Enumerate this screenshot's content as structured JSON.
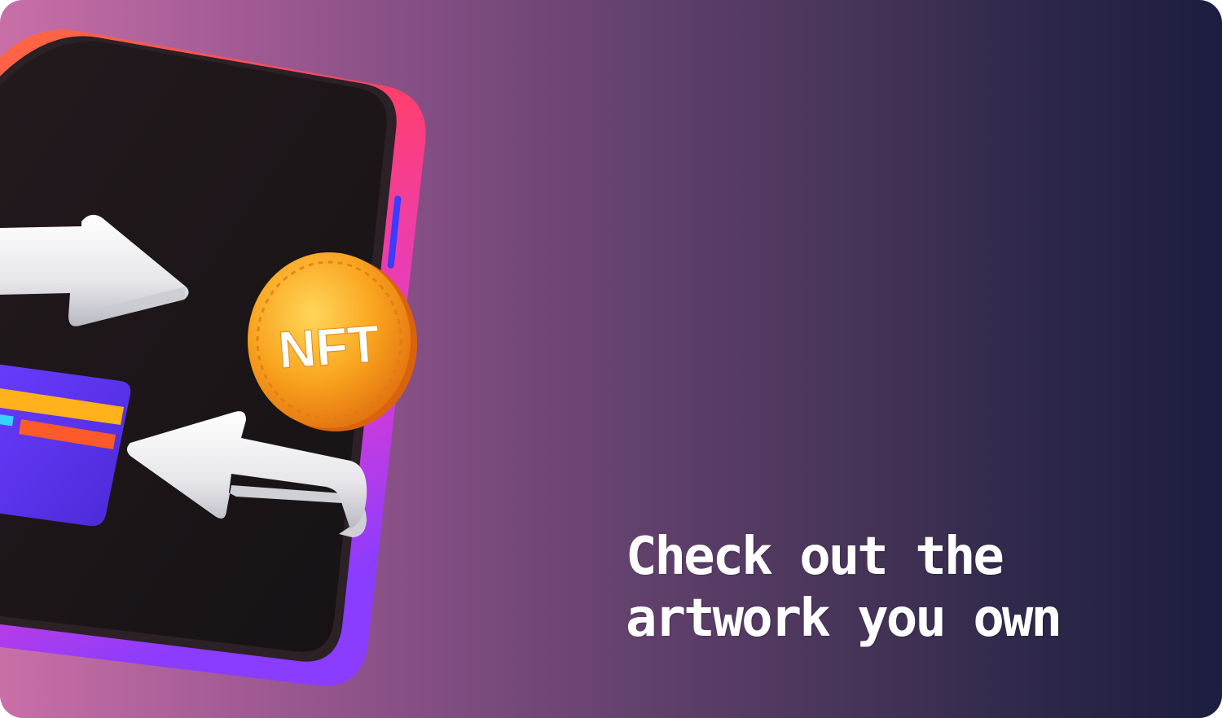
{
  "banner": {
    "coin_label": "NFT",
    "headline_line1": "Check out the",
    "headline_line2": "artwork you own"
  },
  "colors": {
    "background_left": "#c96fa8",
    "background_right": "#1c1d40",
    "phone_screen": "#1d1719",
    "phone_frame_top": "#ff5a3a",
    "phone_frame_bottom": "#b43cff",
    "coin": "#f7a21c",
    "card": "#5b33f0",
    "arrow": "#e9e9ec",
    "headline": "#ffffff"
  },
  "icons": {
    "phone": "smartphone-icon",
    "coin": "nft-coin-icon",
    "card": "credit-card-icon",
    "arrow_right": "arrow-right-icon",
    "arrow_left": "arrow-left-icon"
  }
}
